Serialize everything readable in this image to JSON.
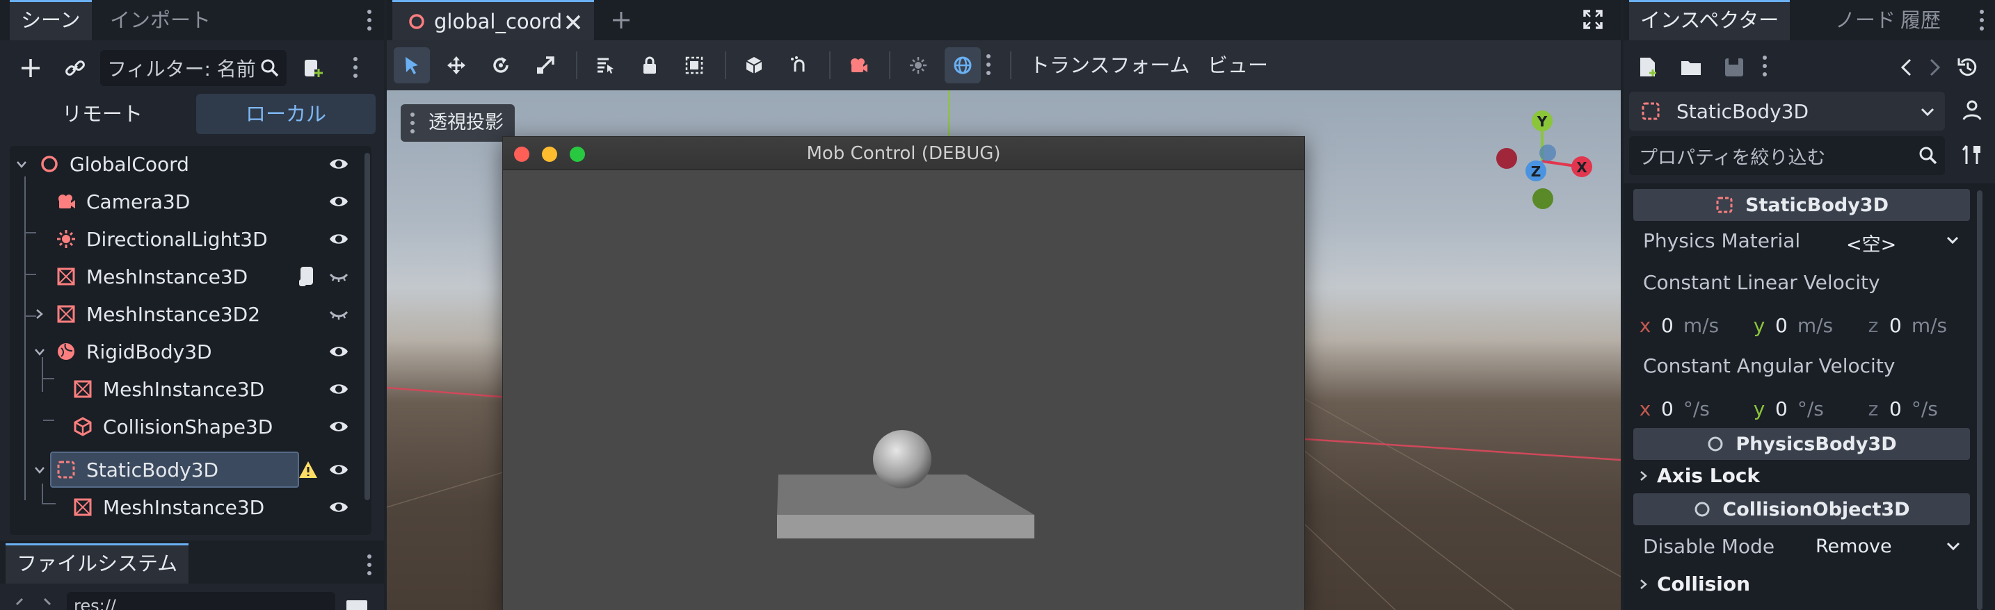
{
  "scene_dock": {
    "tabs": [
      "シーン",
      "インポート"
    ],
    "filter_placeholder": "フィルター: 名前",
    "mode_remote": "リモート",
    "mode_local": "ローカル",
    "tree": [
      {
        "label": "GlobalCoord",
        "icon": "node3d-icon"
      },
      {
        "label": "Camera3D",
        "icon": "camera-icon"
      },
      {
        "label": "DirectionalLight3D",
        "icon": "light-icon"
      },
      {
        "label": "MeshInstance3D",
        "icon": "mesh-icon"
      },
      {
        "label": "MeshInstance3D2",
        "icon": "mesh-icon"
      },
      {
        "label": "RigidBody3D",
        "icon": "rigidbody-icon"
      },
      {
        "label": "MeshInstance3D",
        "icon": "mesh-icon"
      },
      {
        "label": "CollisionShape3D",
        "icon": "collision-shape-icon"
      },
      {
        "label": "StaticBody3D",
        "icon": "staticbody-icon"
      },
      {
        "label": "MeshInstance3D",
        "icon": "mesh-icon"
      }
    ]
  },
  "filesystem_dock": {
    "tab": "ファイルシステム",
    "path": "res://"
  },
  "editor": {
    "doc_tab": "global_coord",
    "toolbar": {
      "transform_menu": "トランスフォーム",
      "view_menu": "ビュー"
    },
    "viewport": {
      "perspective_label": "透視投影",
      "gizmo": {
        "x": "X",
        "y": "Y",
        "z": "Z"
      }
    },
    "debug_window": {
      "title": "Mob Control (DEBUG)"
    }
  },
  "inspector": {
    "tabs": [
      "インスペクター",
      "ノード",
      "履歴"
    ],
    "object_name": "StaticBody3D",
    "filter_placeholder": "プロパティを絞り込む",
    "sections": {
      "staticbody": "StaticBody3D",
      "physicsbody": "PhysicsBody3D",
      "collisionobject": "CollisionObject3D"
    },
    "physics_material": {
      "label": "Physics Material",
      "value": "<空>"
    },
    "linear_velocity": {
      "label": "Constant Linear Velocity",
      "x": "0",
      "y": "0",
      "z": "0",
      "unit": "m/s"
    },
    "angular_velocity": {
      "label": "Constant Angular Velocity",
      "x": "0",
      "y": "0",
      "z": "0",
      "unit": "°/s"
    },
    "axis_lock": "Axis Lock",
    "disable_mode": {
      "label": "Disable Mode",
      "value": "Remove"
    },
    "collision": "Collision"
  },
  "colors": {
    "accent": "#6ab0f3",
    "node_red": "#fc7f7f",
    "axis_x": "#e2364e",
    "axis_y": "#8bc53a",
    "axis_z": "#4a93e0",
    "warning": "#ffdd65"
  }
}
